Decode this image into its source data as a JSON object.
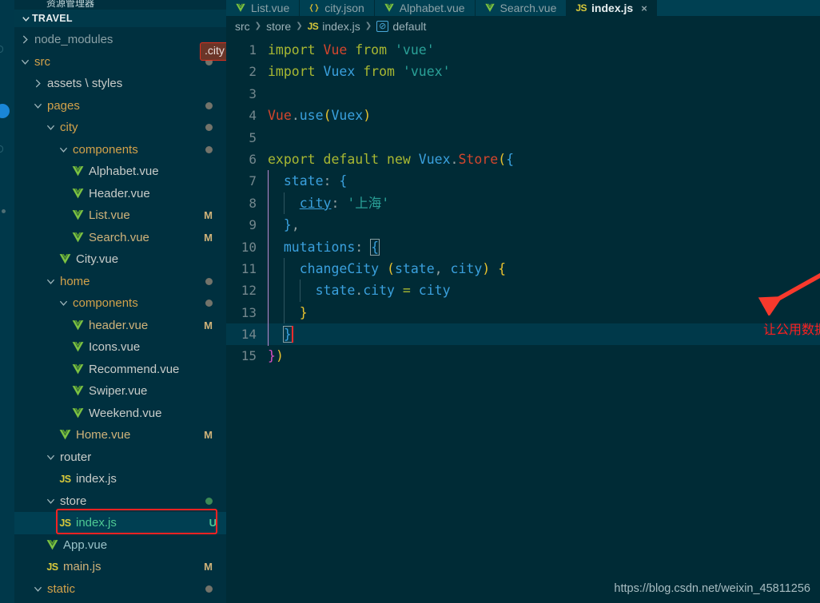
{
  "activitybar": {
    "badge_label": ""
  },
  "sidebar": {
    "explorer_title": "资源管理器",
    "section_title": "TRAVEL",
    "tooltip_badge": ".city",
    "items": [
      {
        "label": "node_modules",
        "indent": 1,
        "type": "folder-collapsed",
        "style": "dim",
        "status": ""
      },
      {
        "label": "src",
        "indent": 1,
        "type": "folder-expanded",
        "style": "folder",
        "status": "dot"
      },
      {
        "label": "assets \\ styles",
        "indent": 2,
        "type": "folder-collapsed",
        "style": "folder-plain",
        "status": ""
      },
      {
        "label": "pages",
        "indent": 2,
        "type": "folder-expanded",
        "style": "folder",
        "status": "dot"
      },
      {
        "label": "city",
        "indent": 3,
        "type": "folder-expanded",
        "style": "folder",
        "status": "dot"
      },
      {
        "label": "components",
        "indent": 4,
        "type": "folder-expanded",
        "style": "folder",
        "status": "dot"
      },
      {
        "label": "Alphabet.vue",
        "indent": 5,
        "type": "vue",
        "style": "vue",
        "status": ""
      },
      {
        "label": "Header.vue",
        "indent": 5,
        "type": "vue",
        "style": "vue",
        "status": ""
      },
      {
        "label": "List.vue",
        "indent": 5,
        "type": "vue",
        "style": "vue-mod",
        "status": "M"
      },
      {
        "label": "Search.vue",
        "indent": 5,
        "type": "vue",
        "style": "vue-mod",
        "status": "M"
      },
      {
        "label": "City.vue",
        "indent": 4,
        "type": "vue",
        "style": "vue",
        "status": ""
      },
      {
        "label": "home",
        "indent": 3,
        "type": "folder-expanded",
        "style": "folder",
        "status": "dot"
      },
      {
        "label": "components",
        "indent": 4,
        "type": "folder-expanded",
        "style": "folder",
        "status": "dot"
      },
      {
        "label": "header.vue",
        "indent": 5,
        "type": "vue",
        "style": "vue-mod",
        "status": "M"
      },
      {
        "label": "Icons.vue",
        "indent": 5,
        "type": "vue",
        "style": "vue",
        "status": ""
      },
      {
        "label": "Recommend.vue",
        "indent": 5,
        "type": "vue",
        "style": "vue",
        "status": ""
      },
      {
        "label": "Swiper.vue",
        "indent": 5,
        "type": "vue",
        "style": "vue",
        "status": ""
      },
      {
        "label": "Weekend.vue",
        "indent": 5,
        "type": "vue",
        "style": "vue",
        "status": ""
      },
      {
        "label": "Home.vue",
        "indent": 4,
        "type": "vue",
        "style": "vue-mod",
        "status": "M"
      },
      {
        "label": "router",
        "indent": 3,
        "type": "folder-expanded",
        "style": "folder-plain",
        "status": ""
      },
      {
        "label": "index.js",
        "indent": 4,
        "type": "js",
        "style": "js",
        "status": ""
      },
      {
        "label": "store",
        "indent": 3,
        "type": "folder-expanded",
        "style": "folder-plain",
        "status": "dot-green"
      },
      {
        "label": "index.js",
        "indent": 4,
        "type": "js",
        "style": "js-green",
        "status": "U",
        "selected": true
      },
      {
        "label": "App.vue",
        "indent": 3,
        "type": "vue",
        "style": "vue-green",
        "status": ""
      },
      {
        "label": "main.js",
        "indent": 3,
        "type": "js",
        "style": "js-mod",
        "status": "M"
      },
      {
        "label": "static",
        "indent": 2,
        "type": "folder-expanded",
        "style": "folder",
        "status": "dot"
      }
    ]
  },
  "editor": {
    "tabs": [
      {
        "label": "List.vue",
        "icon": "vue-icon",
        "active": false
      },
      {
        "label": "city.json",
        "icon": "json-icon",
        "active": false
      },
      {
        "label": "Alphabet.vue",
        "icon": "vue-icon",
        "active": false
      },
      {
        "label": "Search.vue",
        "icon": "vue-icon",
        "active": false
      },
      {
        "label": "index.js",
        "icon": "js-icon",
        "active": true
      }
    ],
    "breadcrumb": [
      "src",
      "store",
      "index.js",
      "default"
    ],
    "lines": [
      {
        "n": "1",
        "text": "import Vue from 'vue'"
      },
      {
        "n": "2",
        "text": "import Vuex from 'vuex'"
      },
      {
        "n": "3",
        "text": ""
      },
      {
        "n": "4",
        "text": "Vue.use(Vuex)"
      },
      {
        "n": "5",
        "text": ""
      },
      {
        "n": "6",
        "text": "export default new Vuex.Store({"
      },
      {
        "n": "7",
        "text": "  state: {"
      },
      {
        "n": "8",
        "text": "    city: '上海'"
      },
      {
        "n": "9",
        "text": "  },"
      },
      {
        "n": "10",
        "text": "  mutations: {"
      },
      {
        "n": "11",
        "text": "    changeCity (state, city) {"
      },
      {
        "n": "12",
        "text": "      state.city = city"
      },
      {
        "n": "13",
        "text": "    }"
      },
      {
        "n": "14",
        "text": "  }"
      },
      {
        "n": "15",
        "text": "})"
      }
    ],
    "current_line": 14
  },
  "annotation": {
    "text": "让公用数据的city等于接收到的city",
    "color": "#ff1f1f",
    "arrow": "red-arrow"
  },
  "watermark": "https://blog.csdn.net/weixin_45811256"
}
